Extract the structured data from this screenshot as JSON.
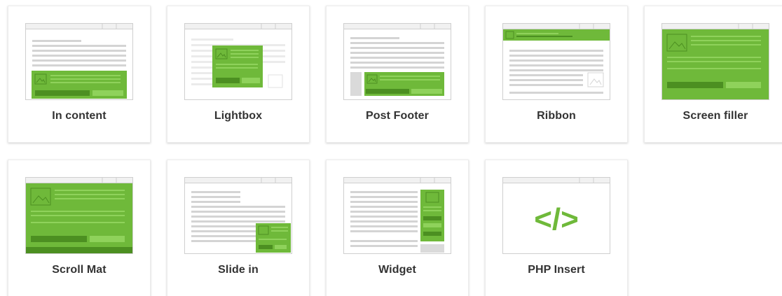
{
  "colors": {
    "accent": "#6fb93a",
    "accent_dark": "#4c8f21",
    "accent_light": "#8fd25b",
    "line_gray": "#d4d4d4",
    "frame_gray": "#cfcfcf",
    "label_text": "#333333"
  },
  "campaign_types": [
    {
      "id": "in-content",
      "label": "In content",
      "icon": "in-content-layout-icon"
    },
    {
      "id": "lightbox",
      "label": "Lightbox",
      "icon": "lightbox-layout-icon"
    },
    {
      "id": "post-footer",
      "label": "Post Footer",
      "icon": "post-footer-layout-icon"
    },
    {
      "id": "ribbon",
      "label": "Ribbon",
      "icon": "ribbon-layout-icon"
    },
    {
      "id": "screen-filler",
      "label": "Screen filler",
      "icon": "screen-filler-layout-icon"
    },
    {
      "id": "scroll-mat",
      "label": "Scroll Mat",
      "icon": "scroll-mat-layout-icon"
    },
    {
      "id": "slide-in",
      "label": "Slide in",
      "icon": "slide-in-layout-icon"
    },
    {
      "id": "widget",
      "label": "Widget",
      "icon": "widget-layout-icon"
    },
    {
      "id": "php-insert",
      "label": "PHP Insert",
      "icon": "code-brackets-icon"
    }
  ],
  "php_glyph": "</>"
}
